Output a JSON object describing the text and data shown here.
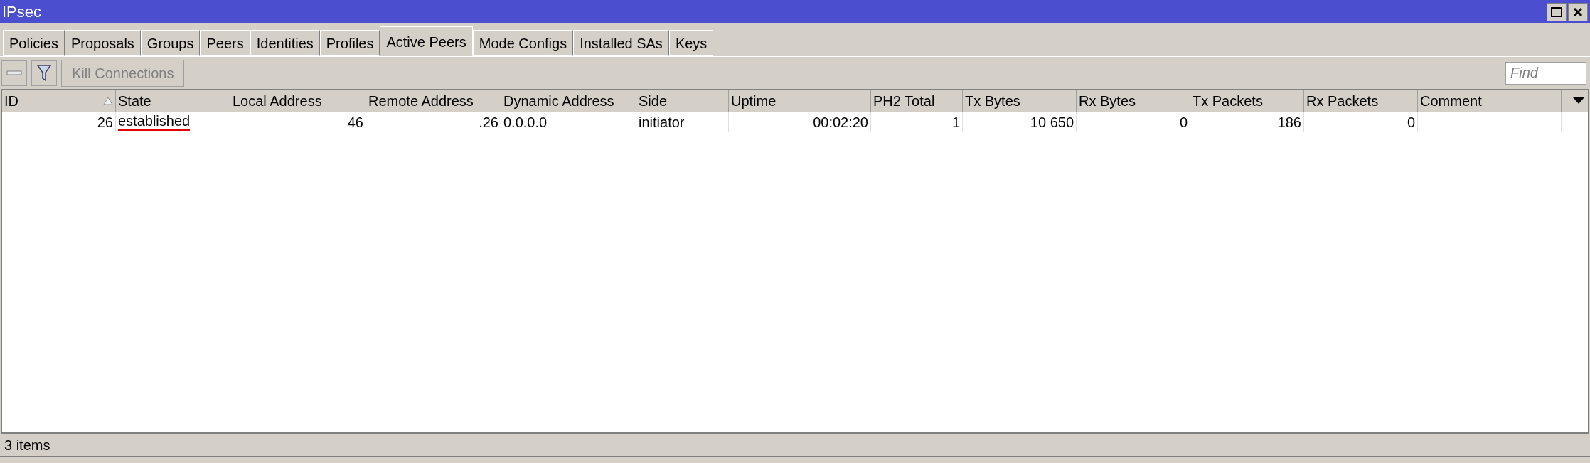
{
  "window": {
    "title": "IPsec"
  },
  "tabs": [
    {
      "label": "Policies",
      "selected": false
    },
    {
      "label": "Proposals",
      "selected": false
    },
    {
      "label": "Groups",
      "selected": false
    },
    {
      "label": "Peers",
      "selected": false
    },
    {
      "label": "Identities",
      "selected": false
    },
    {
      "label": "Profiles",
      "selected": false
    },
    {
      "label": "Active Peers",
      "selected": true
    },
    {
      "label": "Mode Configs",
      "selected": false
    },
    {
      "label": "Installed SAs",
      "selected": false
    },
    {
      "label": "Keys",
      "selected": false
    }
  ],
  "toolbar": {
    "kill_button": {
      "label": "Kill Connections",
      "disabled": true
    },
    "find": {
      "placeholder": "Find"
    }
  },
  "table": {
    "columns": [
      {
        "label": "ID",
        "kind": "numeric",
        "sorted": true
      },
      {
        "label": "State",
        "kind": "text",
        "sorted": false
      },
      {
        "label": "Local Address",
        "kind": "numeric",
        "sorted": false
      },
      {
        "label": "Remote Address",
        "kind": "numeric",
        "sorted": false
      },
      {
        "label": "Dynamic Address",
        "kind": "text",
        "sorted": false
      },
      {
        "label": "Side",
        "kind": "text",
        "sorted": false
      },
      {
        "label": "Uptime",
        "kind": "numeric",
        "sorted": false
      },
      {
        "label": "PH2 Total",
        "kind": "numeric",
        "sorted": false
      },
      {
        "label": "Tx Bytes",
        "kind": "numeric",
        "sorted": false
      },
      {
        "label": "Rx Bytes",
        "kind": "numeric",
        "sorted": false
      },
      {
        "label": "Tx Packets",
        "kind": "numeric",
        "sorted": false
      },
      {
        "label": "Rx Packets",
        "kind": "numeric",
        "sorted": false
      },
      {
        "label": "Comment",
        "kind": "text",
        "sorted": false
      }
    ],
    "rows": [
      {
        "cells": [
          "26",
          "established",
          "46",
          ".26",
          "0.0.0.0",
          "initiator",
          "00:02:20",
          "1",
          "10 650",
          "0",
          "186",
          "0",
          ""
        ],
        "state_underlined": true
      }
    ]
  },
  "status_bar": {
    "text": "3 items"
  }
}
